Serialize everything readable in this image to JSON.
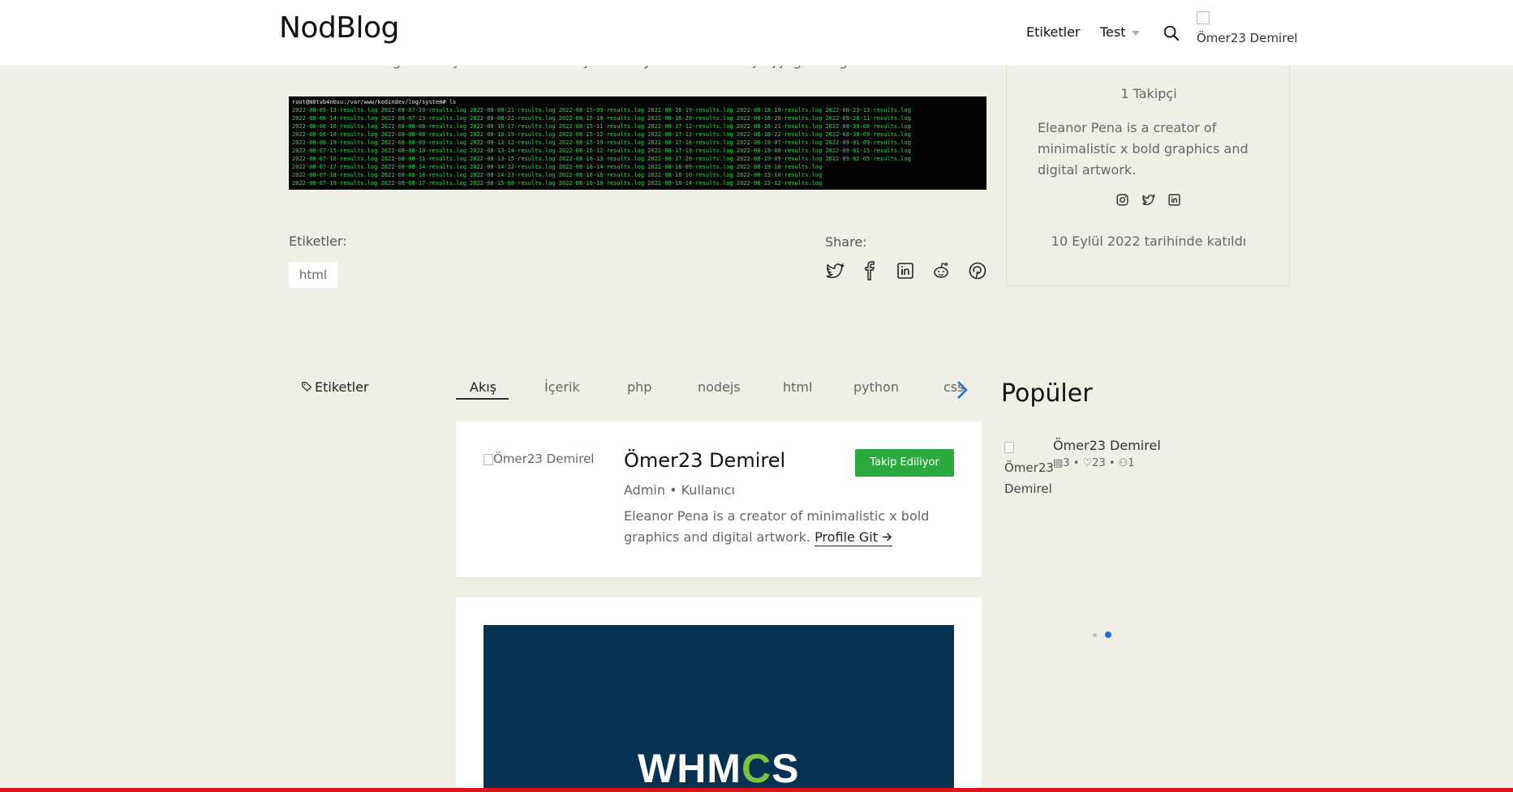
{
  "header": {
    "logo": "NodBlog",
    "nav": {
      "tags": "Etiketler",
      "user_menu": "Test"
    },
    "avatar_alt": "Ömer23 Demirel"
  },
  "article": {
    "cut_text": "Bu özellik ile loglarınızı çok daha rahat bir şekilde ayırabiliriz. Sonuç aşşağıdaki gibi olacaktır;",
    "terminal_prompt": "root@m8tvb4nbsu:/var/www/kodindev/log/system# ls",
    "terminal_rows": [
      "2022-08-05-13-results.log  2022-08-07-20-results.log  2022-08-08-21-results.log  2022-08-15-09-results.log  2022-08-16-19-results.log  2022-08-18-19-results.log  2022-08-23-13-results.log",
      "2022-08-06-14-results.log  2022-08-07-23-results.log  2022-08-08-22-results.log  2022-08-15-10-results.log  2022-08-16-20-results.log  2022-08-18-20-results.log  2022-08-26-11-results.log",
      "2022-08-06-16-results.log  2022-08-08-08-results.log  2022-08-10-17-results.log  2022-08-15-11-results.log  2022-08-17-12-results.log  2022-08-18-21-results.log  2022-08-30-08-results.log",
      "2022-08-06-18-results.log  2022-08-08-08-results.log  2022-08-10-19-results.log  2022-08-15-12-results.log  2022-08-17-13-results.log  2022-08-18-22-results.log  2022-08-30-09-results.log",
      "2022-08-06-19-results.log  2022-08-08-09-results.log  2022-08-13-12-results.log  2022-08-15-19-results.log  2022-08-17-16-results.log  2022-08-19-07-results.log  2022-09-01-09-results.log",
      "2022-08-07-15-results.log  2022-08-08-10-results.log  2022-08-13-14-results.log  2022-08-16-12-results.log  2022-08-17-19-results.log  2022-08-19-08-results.log  2022-09-01-15-results.log",
      "2022-08-07-16-results.log  2022-08-08-11-results.log  2022-08-13-15-results.log  2022-08-16-13-results.log  2022-08-17-20-results.log  2022-08-19-09-results.log  2022-09-02-05-results.log",
      "2022-08-07-17-results.log  2022-08-08-14-results.log  2022-08-14-22-results.log  2022-08-16-14-results.log  2022-08-18-09-results.log  2022-08-19-10-results.log",
      "2022-08-07-18-results.log  2022-08-08-16-results.log  2022-08-14-23-results.log  2022-08-16-16-results.log  2022-08-18-10-results.log  2022-08-23-10-results.log",
      "2022-08-07-19-results.log  2022-08-08-17-results.log  2022-08-15-08-results.log  2022-08-16-18-results.log  2022-08-18-14-results.log  2022-08-23-12-results.log"
    ],
    "tags_label": "Etiketler:",
    "tag": "html",
    "share_label": "Share:"
  },
  "author_card": {
    "followers": "1 Takipçi",
    "bio": "Eleanor Pena is a creator of minimalistic x bold graphics and digital artwork.",
    "joined": "10 Eylül 2022 tarihinde katıldı"
  },
  "tabs_bar": {
    "tags_link": "Etiketler",
    "tabs": [
      "Akış",
      "İçerik",
      "php",
      "nodejs",
      "html",
      "python",
      "css"
    ]
  },
  "profile_card": {
    "img_alt": "Ömer23 Demirel",
    "name": "Ömer23 Demirel",
    "role": "Admin • Kullanıcı",
    "bio": "Eleanor Pena is a creator of minimalistic x bold graphics and digital artwork.",
    "git_link": "Profile Git",
    "follow_button": "Takip Ediliyor"
  },
  "post_card": {
    "image_text_a": "WHM",
    "image_text_gear": "C",
    "image_text_b": "S"
  },
  "popular": {
    "title": "Popüler",
    "item": {
      "img_alt": "Ömer23 Demirel",
      "name": "Ömer23 Demirel",
      "posts": "3",
      "likes": "23",
      "followers": "1"
    }
  },
  "colors": {
    "accent_green": "#2daa3f",
    "bottom_bar": "#d9151b",
    "terminal_text": "#27e14a",
    "slider_active": "#1e6fd9"
  }
}
